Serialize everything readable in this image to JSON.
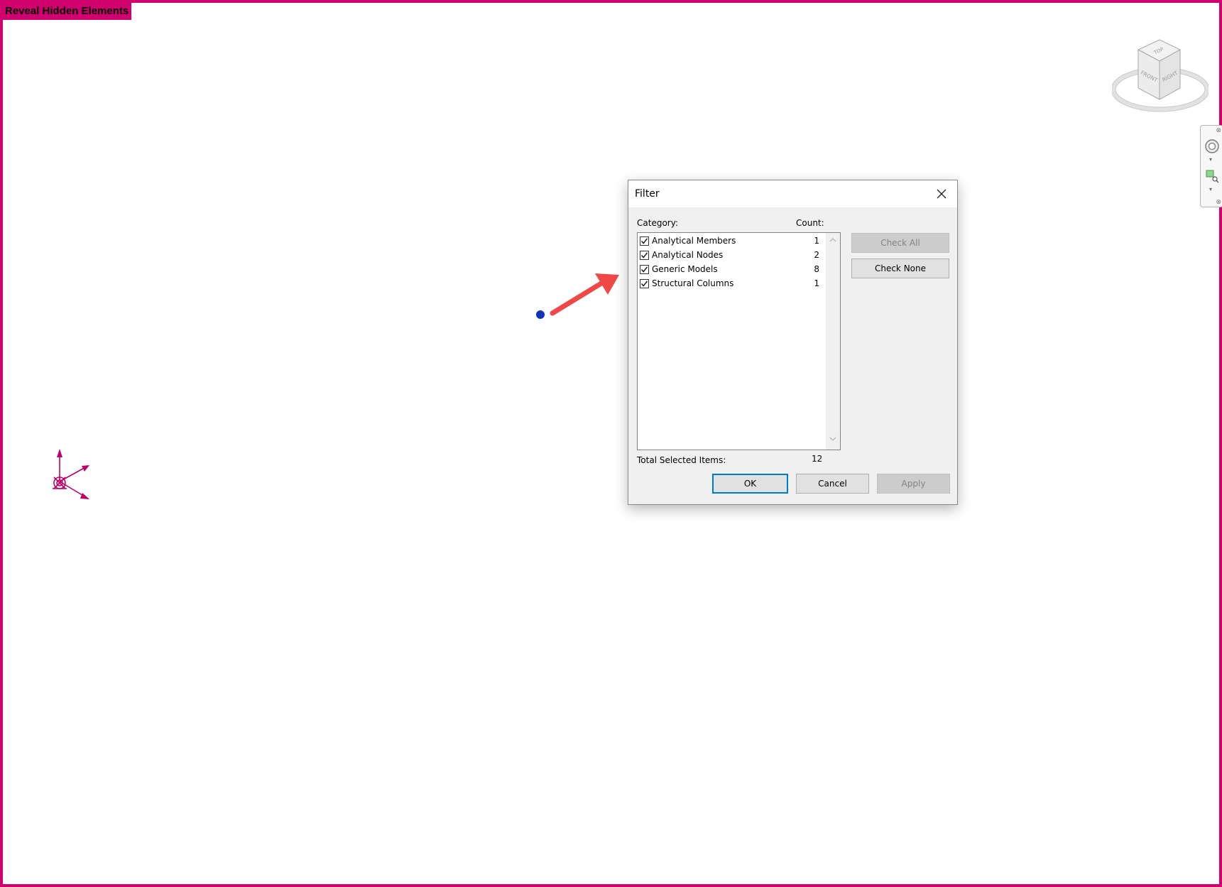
{
  "banner": {
    "label": "Reveal Hidden Elements"
  },
  "colors": {
    "reveal_border": "#d0006f",
    "accent_blue": "#0078d7",
    "annotation_arrow": "#f04747",
    "point": "#1133b8"
  },
  "viewcube": {
    "top": "TOP",
    "front": "FRONT",
    "right": "RIGHT"
  },
  "navbar": {
    "icons": [
      "steering-wheel-icon",
      "zoom-region-icon"
    ]
  },
  "dialog": {
    "title": "Filter",
    "category_header": "Category:",
    "count_header": "Count:",
    "items": [
      {
        "label": "Analytical Members",
        "count": "1",
        "checked": true
      },
      {
        "label": "Analytical Nodes",
        "count": "2",
        "checked": true
      },
      {
        "label": "Generic Models",
        "count": "8",
        "checked": true
      },
      {
        "label": "Structural Columns",
        "count": "1",
        "checked": true
      }
    ],
    "check_all": "Check All",
    "check_none": "Check None",
    "total_label": "Total Selected Items:",
    "total_value": "12",
    "ok": "OK",
    "cancel": "Cancel",
    "apply": "Apply"
  }
}
